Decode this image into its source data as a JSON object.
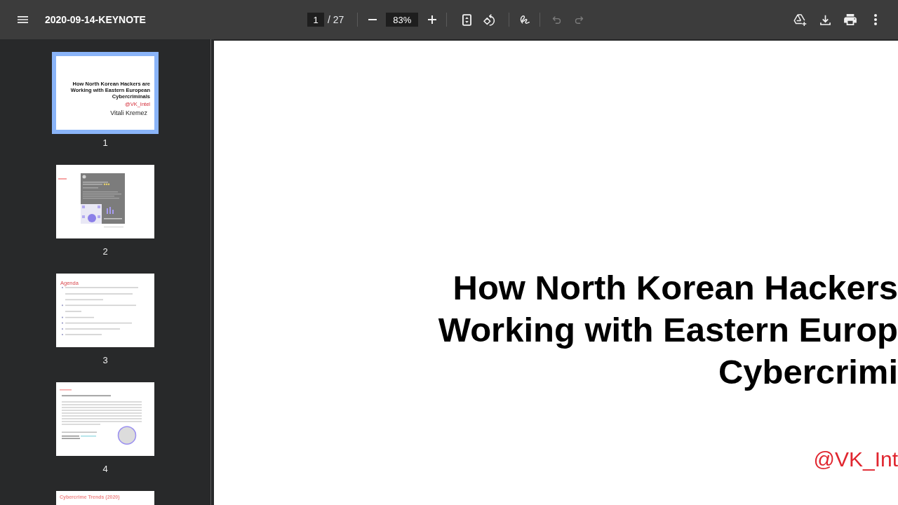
{
  "toolbar": {
    "title": "2020-09-14-KEYNOTE",
    "page_field": {
      "value": "1"
    },
    "page_count": "/ 27",
    "zoom_field": {
      "value": "83%"
    },
    "history": [
      {
        "kind": "undo",
        "disabled": true
      },
      {
        "kind": "redo",
        "disabled": true
      }
    ]
  },
  "sidebar": {
    "thumbnails": [
      {
        "page": "1",
        "selected": true,
        "kind": "title",
        "title_lines": [
          "How North Korean Hackers are",
          "Working with Eastern European",
          "Cybercriminals"
        ],
        "handle": "@VK_Intel",
        "author": "Vitali Kremez"
      },
      {
        "page": "2",
        "selected": false,
        "kind": "screenshot"
      },
      {
        "page": "3",
        "selected": false,
        "kind": "agenda",
        "heading": "Agenda"
      },
      {
        "page": "4",
        "selected": false,
        "kind": "profile"
      },
      {
        "selected": false,
        "kind": "heading",
        "heading": "Cybercrime Trends (2020)"
      }
    ]
  },
  "document": {
    "title_lines": [
      "How North Korean Hackers",
      "Working with Eastern Europ",
      "Cybercrimi"
    ],
    "handle": "@VK_Int"
  }
}
